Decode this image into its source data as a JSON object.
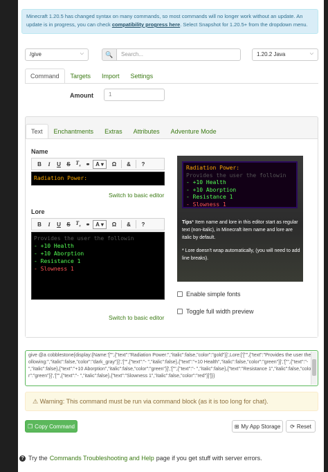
{
  "info": {
    "text1": "Minecraft 1.20.5 has changed syntax on many commands, so most commands will no longer work without an update. An update is in progress, you can check ",
    "link": "compatibility progress here",
    "text2": ". Select Snapshot for 1.20.5+ from the dropdown menu."
  },
  "topbar": {
    "command_select": "/give",
    "search_placeholder": "Search...",
    "version_select": "1.20.2 Java"
  },
  "main_tabs": [
    "Command",
    "Targets",
    "Import",
    "Settings"
  ],
  "amount": {
    "label": "Amount",
    "value": "1"
  },
  "sub_tabs": [
    "Text",
    "Enchantments",
    "Extras",
    "Attributes",
    "Adventure Mode"
  ],
  "name_field": {
    "label": "Name",
    "text": "Radiation Power:",
    "switch_link": "Switch to basic editor"
  },
  "lore_field": {
    "label": "Lore",
    "lines": [
      {
        "text": "Provides the user the followin",
        "color": "dark_gray"
      },
      {
        "text": "- +10 Health",
        "color": "green"
      },
      {
        "text": "- +10 Aborption",
        "color": "green"
      },
      {
        "text": "- Resistance 1",
        "color": "green"
      },
      {
        "text": "- Slowness 1",
        "color": "red"
      }
    ],
    "switch_link": "Switch to basic editor"
  },
  "toolbar_icons": [
    "bold-icon",
    "italic-icon",
    "underline-icon",
    "strikethrough-icon",
    "clear-format-icon",
    "link-icon",
    "text-color-icon",
    "omega-icon",
    "obfuscate-icon",
    "help-icon"
  ],
  "preview": {
    "title": "Radiation Power:",
    "lines": [
      {
        "text": "Provides the user the followin",
        "color": "dark_gray"
      },
      {
        "text": "- +10 Health",
        "color": "green"
      },
      {
        "text": "- +10 Aborption",
        "color": "green"
      },
      {
        "text": "- Resistance 1",
        "color": "green"
      },
      {
        "text": "- Slowness 1",
        "color": "red"
      }
    ],
    "tips_bold": "Tips",
    "tips_text": "* Item name and lore in this editor start as regular text (non-italic), in Minecraft item name and lore are italic by default.",
    "tips_text2": "* Lore doesn't wrap automatically, (you will need to add line breaks)."
  },
  "options": {
    "simple_fonts": "Enable simple fonts",
    "full_width": "Toggle full width preview"
  },
  "command_output": "give @a cobblestone{display:{Name:'[\"\",{\"text\":\"Radiation Power:\",\"italic\":false,\"color\":\"gold\"}]',Lore:['[\"\",{\"text\":\"Provides the user the following:\",\"italic\":false,\"color\":\"dark_gray\"}]','[\"\",{\"text\":\"- \",\"italic\":false},{\"text\":\"+10 Health\",\"italic\":false,\"color\":\"green\"}]','[\"\",{\"text\":\"- \",\"italic\":false},{\"text\":\"+10 Aborption\",\"italic\":false,\"color\":\"green\"}]','[\"\",{\"text\":\"- \",\"italic\":false},{\"text\":\"Resistance 1\",\"italic\":false,\"color\":\"green\"}]','[\"\",{\"text\":\"- \",\"italic\":false},{\"text\":\"Slowness 1\",\"italic\":false,\"color\":\"red\"}]']}}",
  "warning": "Warning: This command must be run via command block (as it is too long for chat).",
  "buttons": {
    "copy": "Copy Command",
    "storage": "My App Storage",
    "reset": "Reset"
  },
  "footer": {
    "before": "Try the ",
    "link": "Commands Troubleshooting and Help",
    "after": " page if you get stuff with server errors."
  },
  "colors": {
    "gold": "#ffaa00",
    "dark_gray": "#555555",
    "green": "#55ff55",
    "red": "#ff5555",
    "link": "#3b7a14"
  }
}
